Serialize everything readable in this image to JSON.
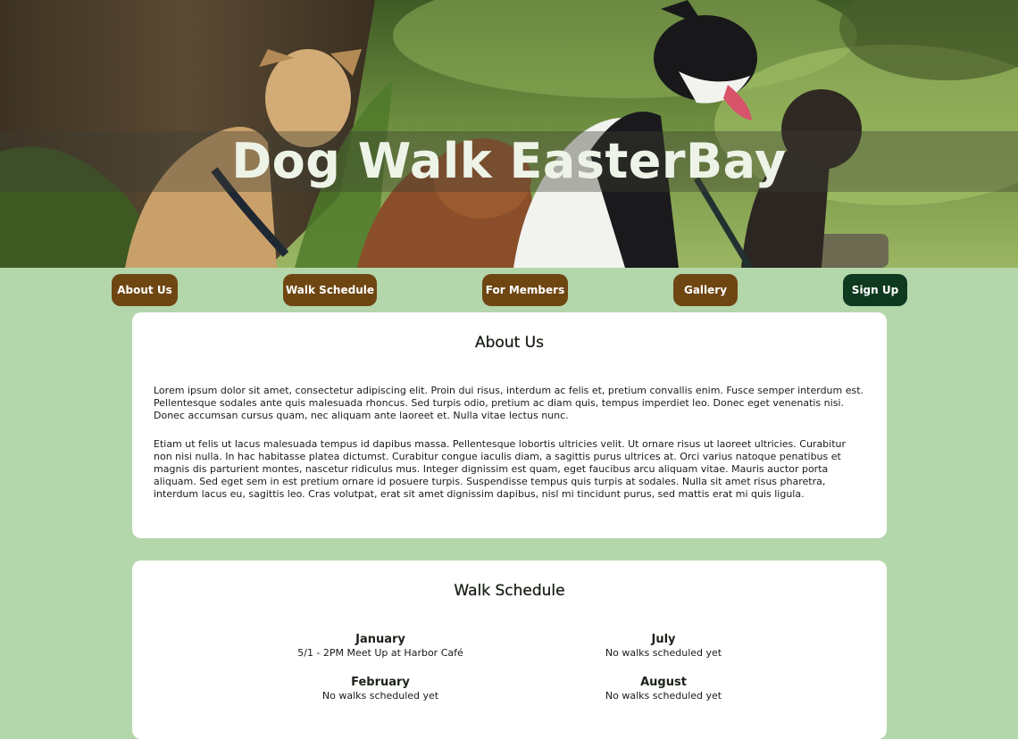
{
  "header": {
    "title": "Dog Walk EasterBay",
    "image": "photo of four dogs sitting in a park"
  },
  "nav": {
    "items": [
      {
        "label": "About Us"
      },
      {
        "label": "Walk Schedule"
      },
      {
        "label": "For Members"
      },
      {
        "label": "Gallery"
      },
      {
        "label": "Sign Up"
      }
    ]
  },
  "about": {
    "heading": "About Us",
    "paragraphs": [
      "Lorem ipsum dolor sit amet, consectetur adipiscing elit. Proin dui risus, interdum ac felis et, pretium convallis enim. Fusce semper interdum est. Pellentesque sodales ante quis malesuada rhoncus. Sed turpis odio, pretium ac diam quis, tempus imperdiet leo. Donec eget venenatis nisi. Donec accumsan cursus quam, nec aliquam ante laoreet et. Nulla vitae lectus nunc.",
      "Etiam ut felis ut lacus malesuada tempus id dapibus massa. Pellentesque lobortis ultricies velit. Ut ornare risus ut laoreet ultricies. Curabitur non nisi nulla. In hac habitasse platea dictumst. Curabitur congue iaculis diam, a sagittis purus ultrices at. Orci varius natoque penatibus et magnis dis parturient montes, nascetur ridiculus mus. Integer dignissim est quam, eget faucibus arcu aliquam vitae. Mauris auctor porta aliquam. Sed eget sem in est pretium ornare id posuere turpis. Suspendisse tempus quis turpis at sodales. Nulla sit amet risus pharetra, interdum lacus eu, sagittis leo. Cras volutpat, erat sit amet dignissim dapibus, nisl mi tincidunt purus, sed mattis erat mi quis ligula."
    ]
  },
  "schedule": {
    "heading": "Walk Schedule",
    "months": [
      {
        "name": "January",
        "note": "5/1 - 2PM Meet Up at Harbor Café"
      },
      {
        "name": "July",
        "note": "No walks scheduled yet"
      },
      {
        "name": "February",
        "note": "No walks scheduled yet"
      },
      {
        "name": "August",
        "note": "No walks scheduled yet"
      }
    ]
  },
  "colors": {
    "page_background": "#b4d6ab",
    "nav_button": "#6e4612",
    "signup_button": "#0f3a1f",
    "card": "#ffffff"
  }
}
